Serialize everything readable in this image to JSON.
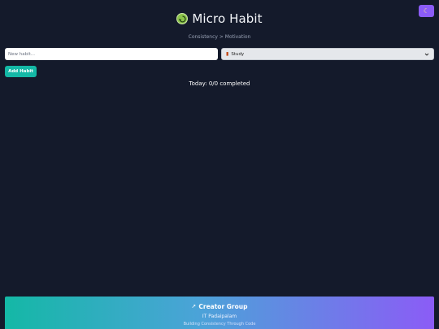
{
  "header": {
    "title": "Micro Habit",
    "tagline": "Consistency > Motivation",
    "logo_icon": "recycle-icon",
    "theme_toggle_icon": "moon-icon"
  },
  "form": {
    "habit_placeholder": "New habit...",
    "category_selected": "Study",
    "category_icon": "books-icon",
    "add_label": "Add Habit"
  },
  "progress": {
    "text": "Today: 0/0 completed"
  },
  "footer": {
    "title": "Creator Group",
    "title_icon": "rocket-icon",
    "subtitle": "IT Padaipalam",
    "tagline": "Building Consistency Through Code"
  },
  "colors": {
    "background": "#141a2b",
    "accent_teal": "#14b8a6",
    "accent_purple": "#8b5cf6"
  }
}
